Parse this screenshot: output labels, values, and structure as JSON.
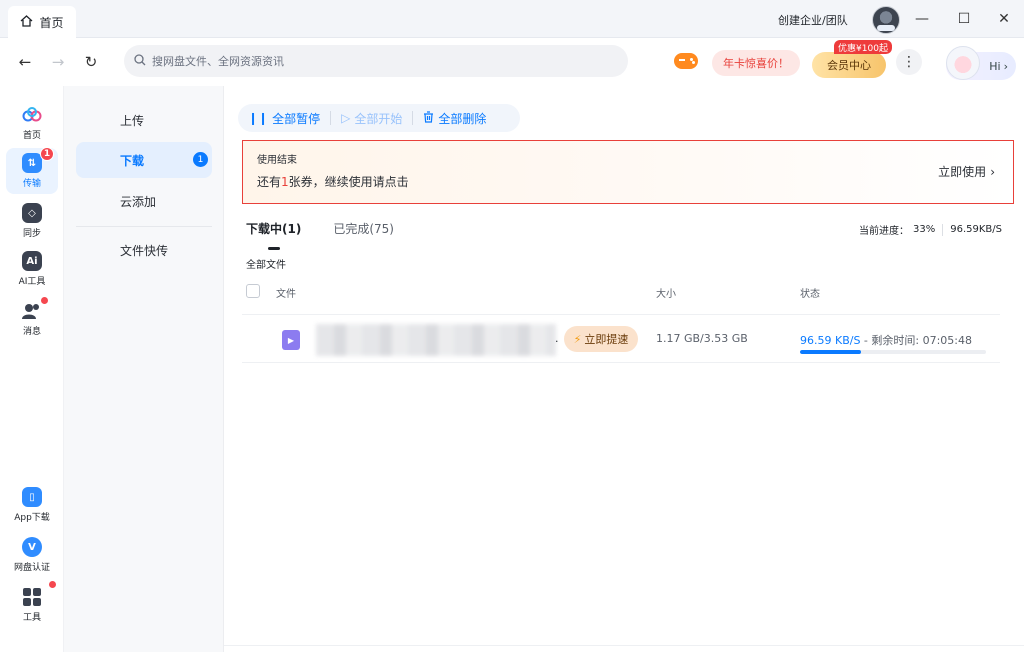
{
  "titlebar": {
    "home_tab": "首页",
    "enterprise_label": "创建企业/团队",
    "minimize": "—",
    "maximize": "☐",
    "close": "✕"
  },
  "nav": {
    "back": "←",
    "forward": "→",
    "refresh": "↻",
    "search_placeholder": "搜网盘文件、全网资源资讯",
    "annual_button": "年卡惊喜价！",
    "vip_button": "会员中心",
    "promo_badge": "优惠¥100起",
    "more": "⋮",
    "hi_button": "Hi"
  },
  "rail": {
    "items": [
      {
        "label": "首页",
        "icon": "cloud-icon"
      },
      {
        "label": "传输",
        "icon": "transfer-icon",
        "badge": "1"
      },
      {
        "label": "同步",
        "icon": "sync-icon"
      },
      {
        "label": "AI工具",
        "icon": "ai-tools-icon"
      },
      {
        "label": "消息",
        "icon": "message-icon"
      }
    ],
    "bottom_items": [
      {
        "label": "App下载",
        "icon": "phone-icon"
      },
      {
        "label": "网盘认证",
        "icon": "verify-icon"
      },
      {
        "label": "工具",
        "icon": "grid-icon"
      }
    ]
  },
  "subnav": {
    "items": [
      {
        "label": "上传"
      },
      {
        "label": "下载",
        "badge": "1"
      },
      {
        "label": "云添加"
      },
      {
        "label": "文件快传"
      }
    ]
  },
  "toolbar": {
    "pause_all": "全部暂停",
    "start_all": "全部开始",
    "delete_all": "全部删除"
  },
  "notice": {
    "title": "使用结束",
    "desc_prefix": "还有",
    "desc_highlight": "1",
    "desc_suffix": "张券，继续使用请点击",
    "action": "立即使用"
  },
  "tabs": {
    "downloading": "下载中(1)",
    "completed": "已完成(75)"
  },
  "progress_summary": {
    "label": "当前进度：",
    "percent": "33%",
    "speed": "96.59KB/S"
  },
  "list": {
    "section": "全部文件",
    "headers": {
      "file": "文件",
      "size": "大小",
      "status": "状态"
    },
    "rows": [
      {
        "name_suffix": ".",
        "boost": "立即提速",
        "size": "1.17 GB/3.53 GB",
        "speed": "96.59 KB/S",
        "remaining": " - 剩余时间: 07:05:48",
        "progress": 0.33
      }
    ]
  },
  "colors": {
    "accent": "#0a7aff",
    "alert_border": "#e8403a",
    "badge_red": "#f5474f",
    "file_icon": "#8c7cf0"
  }
}
